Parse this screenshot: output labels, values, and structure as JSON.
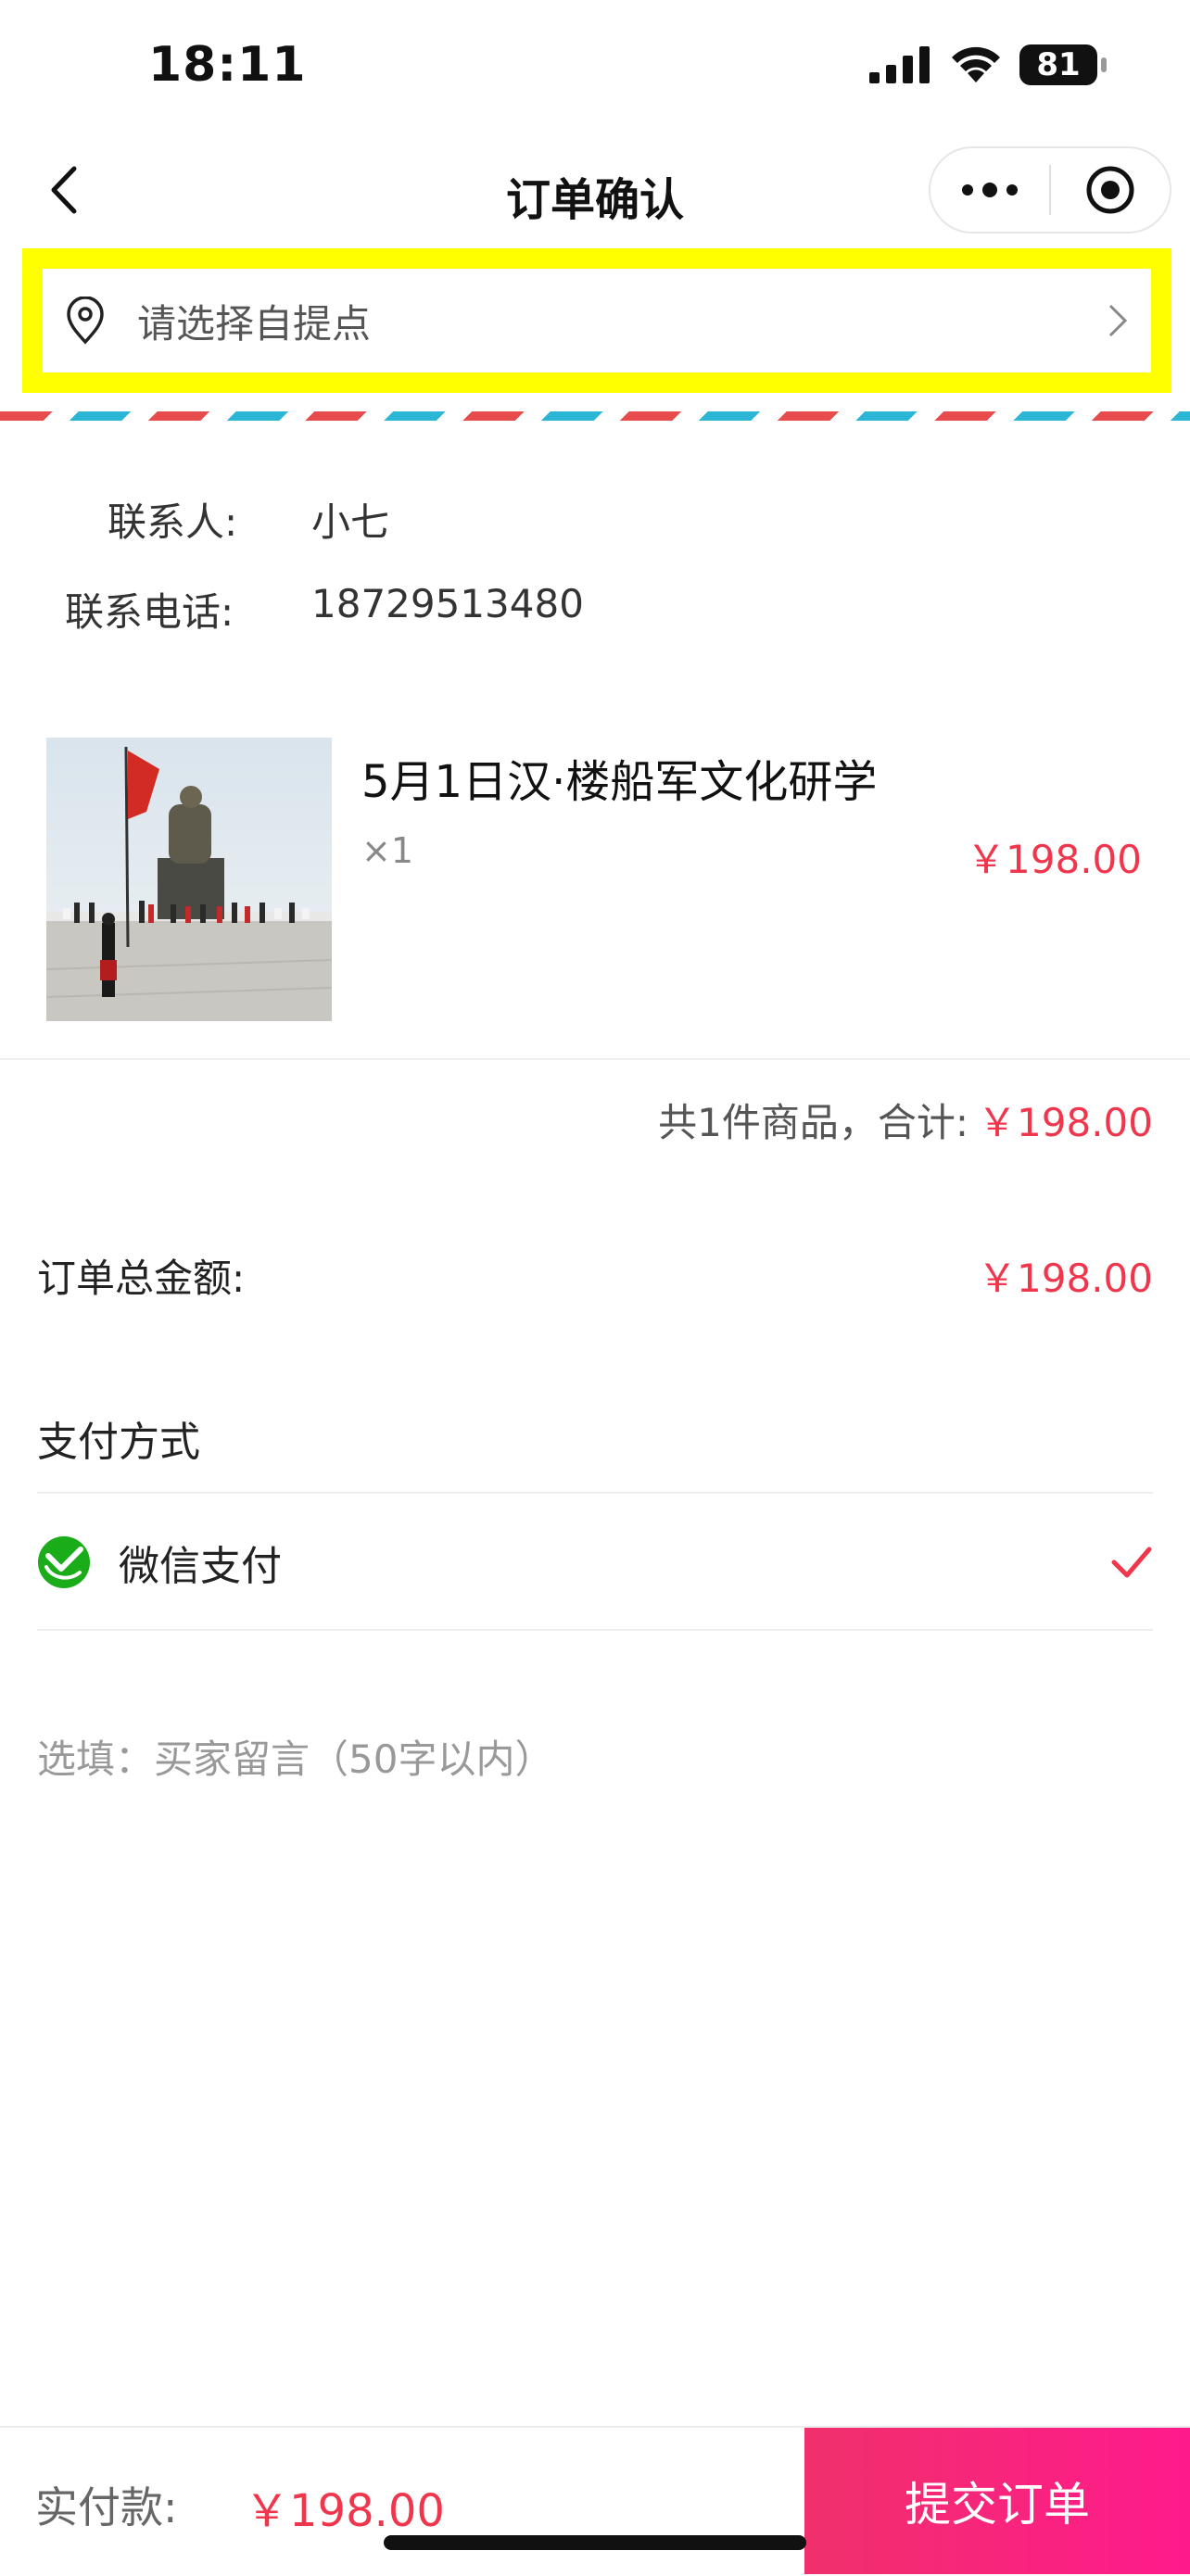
{
  "status_bar": {
    "time": "18:11",
    "battery": "81"
  },
  "nav": {
    "title": "订单确认"
  },
  "pickup": {
    "placeholder_text": "请选择自提点"
  },
  "contact": {
    "name_label": "联系人:",
    "name": "小七",
    "phone_label": "联系电话:",
    "phone": "18729513480"
  },
  "product": {
    "title": "5月1日汉·楼船军文化研学",
    "quantity": "×1",
    "price": "￥198.00"
  },
  "summary": {
    "label": "共1件商品，合计:",
    "value": "￥198.00"
  },
  "order_total": {
    "label": "订单总金额:",
    "value": "￥198.00"
  },
  "payment": {
    "title": "支付方式",
    "method": "微信支付",
    "selected": true
  },
  "remark": {
    "placeholder": "选填：买家留言（50字以内）"
  },
  "footer": {
    "pay_label": "实付款:",
    "pay_value": "￥198.00",
    "submit_label": "提交订单"
  },
  "colors": {
    "accent_red": "#f0364d",
    "wechat_green": "#1aad19",
    "submit_gradient_start": "#f0306c",
    "submit_gradient_end": "#ff1a8c",
    "highlight_yellow": "#ffff00"
  }
}
